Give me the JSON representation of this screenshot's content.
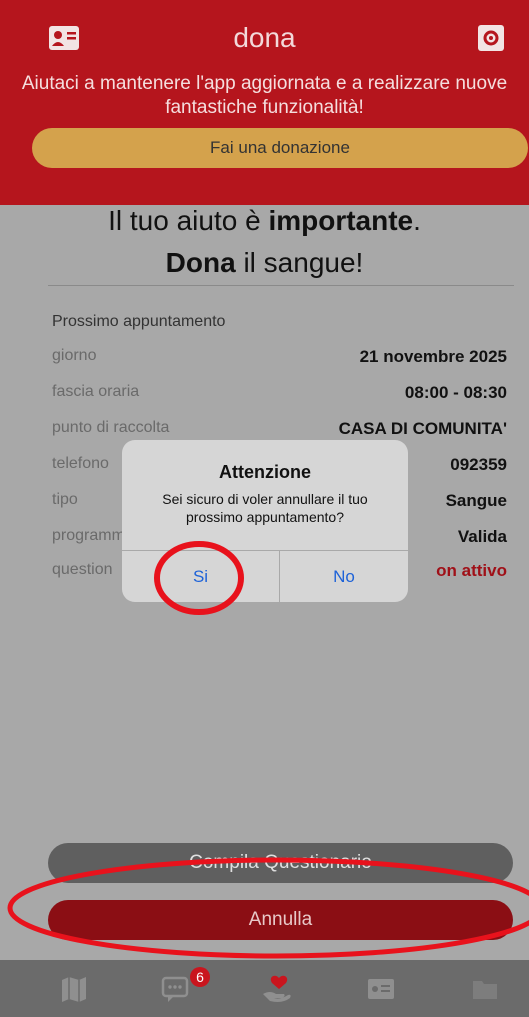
{
  "header": {
    "title": "dona",
    "support_text": "Aiutaci a mantenere l'app aggiornata e a realizzare nuove fantastiche funzionalità!",
    "donate_label": "Fai una donazione",
    "left_icon": "contact-card-icon",
    "right_icon": "settings-icon"
  },
  "headline": {
    "line1_part1": "Il tuo aiuto è ",
    "line1_bold": "importante",
    "line1_end": ".",
    "line2_bold": "Dona",
    "line2_rest": " il sangue!"
  },
  "appointment": {
    "title": "Prossimo appuntamento",
    "rows": [
      {
        "label": "giorno",
        "value": "21 novembre 2025"
      },
      {
        "label": "fascia oraria",
        "value": "08:00 - 08:30"
      },
      {
        "label": "punto di raccolta",
        "value": "CASA DI COMUNITA'"
      },
      {
        "label": "telefono",
        "value": "092359"
      },
      {
        "label": "tipo",
        "value": "Sangue"
      },
      {
        "label": "programm",
        "value": "Valida"
      },
      {
        "label": "question",
        "value": "on attivo"
      }
    ]
  },
  "buttons": {
    "questionnaire": "Compila Questionario",
    "cancel": "Annulla"
  },
  "dialog": {
    "title": "Attenzione",
    "message": "Sei sicuro di voler annullare il tuo prossimo appuntamento?",
    "yes": "Si",
    "no": "No"
  },
  "tabbar": {
    "badge": "6",
    "tabs": [
      "map-icon",
      "chat-icon",
      "donate-heart-icon",
      "id-card-icon",
      "folder-icon"
    ]
  },
  "colors": {
    "brand_red": "#b5151d",
    "donate_gold": "#d4a24c",
    "link_blue": "#1d62d8",
    "annotation_red": "#e8121c"
  }
}
